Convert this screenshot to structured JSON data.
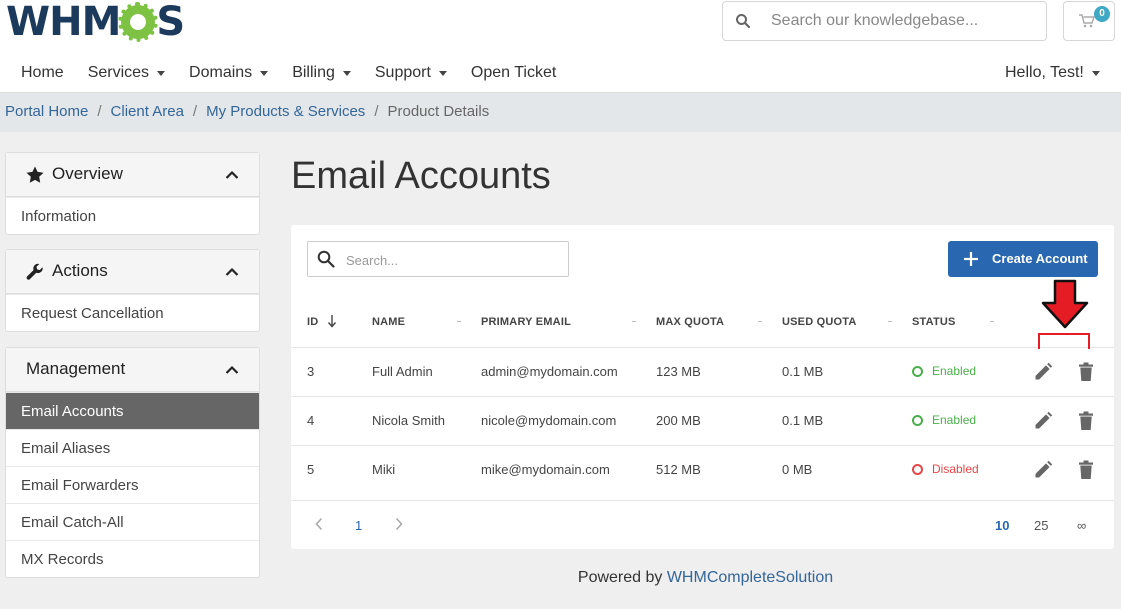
{
  "brand": {
    "logo_text_left": "WHM",
    "logo_text_right": "S",
    "gear_color": "#7dc242"
  },
  "header": {
    "search_placeholder": "Search our knowledgebase...",
    "cart_count": "0",
    "nav": [
      {
        "label": "Home",
        "dropdown": false
      },
      {
        "label": "Services",
        "dropdown": true
      },
      {
        "label": "Domains",
        "dropdown": true
      },
      {
        "label": "Billing",
        "dropdown": true
      },
      {
        "label": "Support",
        "dropdown": true
      },
      {
        "label": "Open Ticket",
        "dropdown": false
      }
    ],
    "user_label": "Hello, Test!"
  },
  "breadcrumb": {
    "items": [
      "Portal Home",
      "Client Area",
      "My Products & Services"
    ],
    "current": "Product Details"
  },
  "sidebar": {
    "overview": {
      "title": "Overview",
      "items": [
        "Information"
      ]
    },
    "actions": {
      "title": "Actions",
      "items": [
        "Request Cancellation"
      ]
    },
    "management": {
      "title": "Management",
      "items": [
        "Email Accounts",
        "Email Aliases",
        "Email Forwarders",
        "Email Catch-All",
        "MX Records"
      ],
      "active_index": 0
    }
  },
  "main": {
    "title": "Email Accounts",
    "search_placeholder": "Search...",
    "create_label": "Create Account",
    "columns": [
      "ID",
      "NAME",
      "PRIMARY EMAIL",
      "MAX QUOTA",
      "USED QUOTA",
      "STATUS"
    ],
    "rows": [
      {
        "id": "3",
        "name": "Full Admin",
        "email": "admin@mydomain.com",
        "max": "123 MB",
        "used": "0.1 MB",
        "status": "Enabled"
      },
      {
        "id": "4",
        "name": "Nicola Smith",
        "email": "nicole@mydomain.com",
        "max": "200 MB",
        "used": "0.1 MB",
        "status": "Enabled"
      },
      {
        "id": "5",
        "name": "Miki",
        "email": "mike@mydomain.com",
        "max": "512 MB",
        "used": "0 MB",
        "status": "Disabled"
      }
    ],
    "pager": {
      "current_page": "1",
      "sizes": [
        "10",
        "25",
        "∞"
      ],
      "active_size": "10"
    },
    "colors": {
      "enabled": "#4cae4c",
      "disabled": "#e54848",
      "accent": "#2968b0",
      "highlight": "#e51c24"
    }
  },
  "footer": {
    "prefix": "Powered by ",
    "link": "WHMCompleteSolution"
  }
}
